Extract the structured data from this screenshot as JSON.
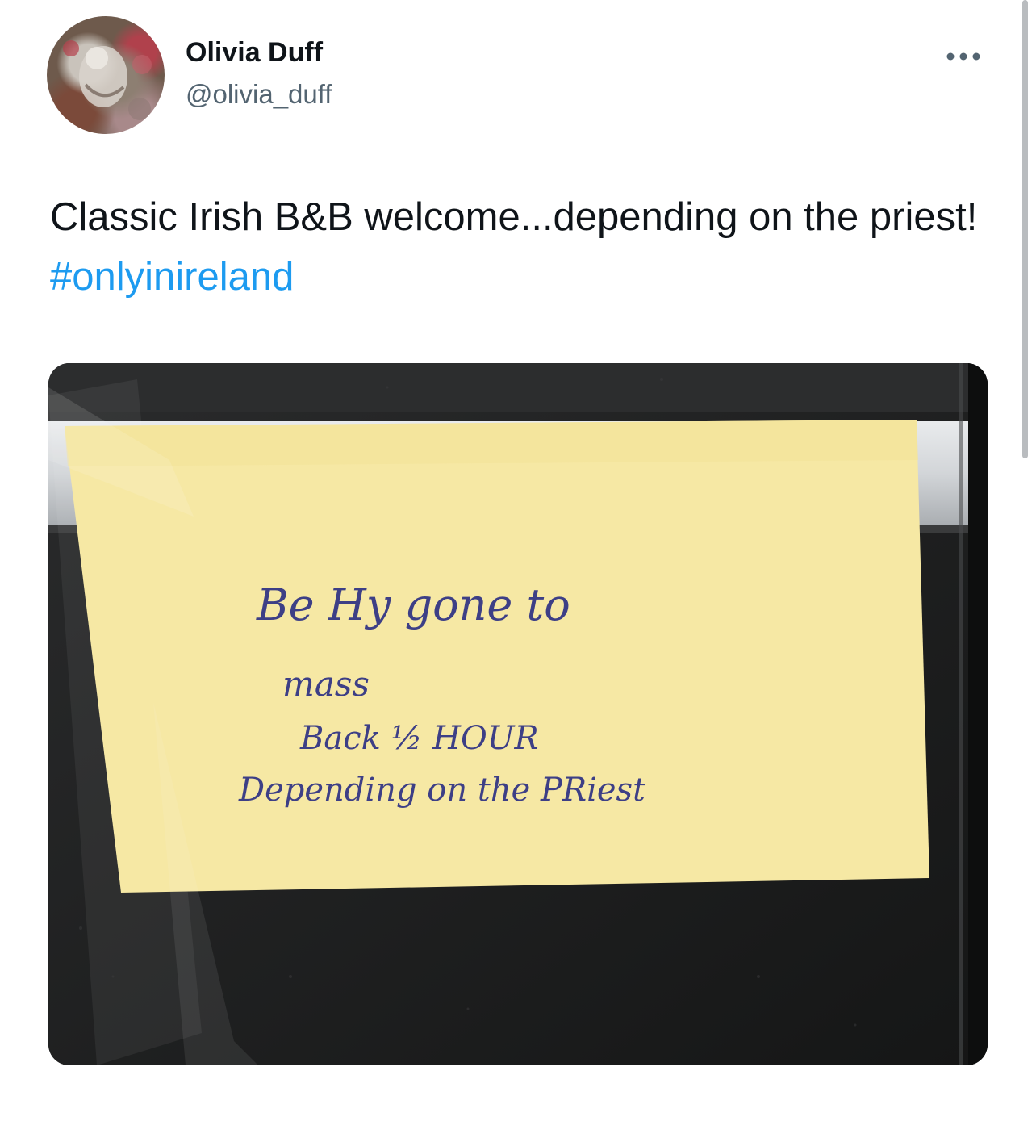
{
  "tweet": {
    "author": {
      "display_name": "Olivia Duff",
      "handle": "@olivia_duff",
      "avatar_icon": "user-avatar-icon"
    },
    "more_icon": "more-horizontal-icon",
    "text": "Classic Irish B&B welcome...depending on the priest! ",
    "hashtag": "#onlyinireland",
    "media": {
      "note_lines": [
        "Be Hy gone to",
        "mass",
        "Back ½ HOUR",
        "Depending on the PRiest"
      ],
      "note_color": "#f6e8a4"
    }
  },
  "colors": {
    "text": "#0f1419",
    "secondary": "#536471",
    "link": "#1d9bf0"
  }
}
